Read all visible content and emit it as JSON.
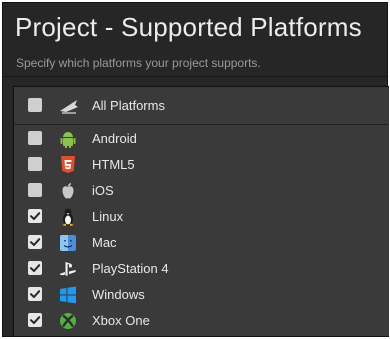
{
  "dialog": {
    "title": "Project - Supported Platforms",
    "subtitle": "Specify which platforms your project supports."
  },
  "all_platforms": {
    "label": "All Platforms",
    "checked": false,
    "icon": "all-platforms-icon"
  },
  "platforms": [
    {
      "label": "Android",
      "checked": false,
      "icon": "android-icon",
      "color": "#8bc34a"
    },
    {
      "label": "HTML5",
      "checked": false,
      "icon": "html5-icon",
      "color": "#e44d26"
    },
    {
      "label": "iOS",
      "checked": false,
      "icon": "apple-icon",
      "color": "#c8c8c8"
    },
    {
      "label": "Linux",
      "checked": true,
      "icon": "linux-icon",
      "color": "#f5f5f5"
    },
    {
      "label": "Mac",
      "checked": true,
      "icon": "mac-icon",
      "color": "#4a90d9"
    },
    {
      "label": "PlayStation 4",
      "checked": true,
      "icon": "playstation-icon",
      "color": "#f2f2f2"
    },
    {
      "label": "Windows",
      "checked": true,
      "icon": "windows-icon",
      "color": "#1e9bf0"
    },
    {
      "label": "Xbox One",
      "checked": true,
      "icon": "xbox-icon",
      "color": "#52b043"
    }
  ]
}
